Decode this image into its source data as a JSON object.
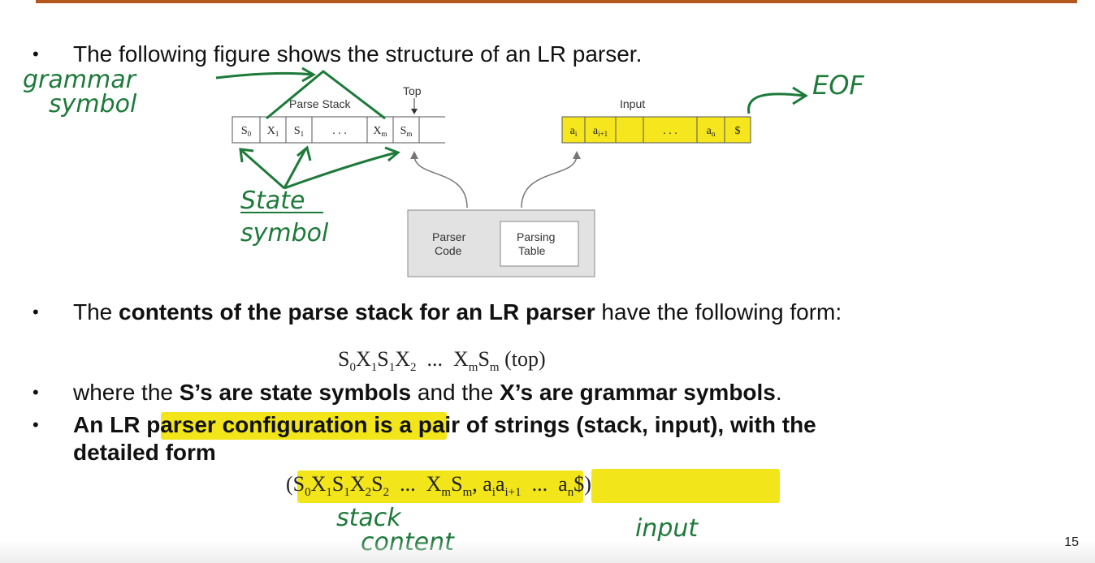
{
  "slide": {
    "bullet1": "The following figure shows the structure of an LR parser.",
    "bullet2": {
      "pre": "The ",
      "bold": "contents of the parse stack for an LR parser",
      "post": " have the following form:"
    },
    "stack_form": {
      "s0": "S",
      "s0sub": "0",
      "x1": "X",
      "x1sub": "1",
      "s1": "S",
      "s1sub": "1",
      "x2": "X",
      "x2sub": "2",
      "dots": "...",
      "xm": "X",
      "xmsub": "m",
      "sm": "S",
      "smsub": "m",
      "top": "(top)"
    },
    "bullet3": {
      "pre": "where the ",
      "bold1": "S’s are state symbols",
      "mid": " and the ",
      "bold2": "X’s are grammar symbols",
      "post": "."
    },
    "bullet4": {
      "bold": "An LR parser configuration",
      "rest": " is a pair of strings (stack, input), with the",
      "line2": "detailed form"
    },
    "config": {
      "open": "(",
      "s0": "S",
      "s0sub": "0",
      "x1": "X",
      "x1sub": "1",
      "s1": "S",
      "s1sub": "1",
      "x2": "X",
      "x2sub": "2",
      "s2": "S",
      "s2sub": "2",
      "dots1": "...",
      "xm": "X",
      "xmsub": "m",
      "sm": "S",
      "smsub": "m",
      "comma": ",",
      "ai": "a",
      "aisub": "i",
      "ai1": "a",
      "ai1sub": "i+1",
      "dots2": "...",
      "an": "a",
      "ansub": "n",
      "dollar": "$",
      "close": ")"
    },
    "page_number": "15"
  },
  "figure": {
    "parse_stack_label": "Parse Stack",
    "top_label": "Top",
    "input_label": "Input",
    "stack_cells": [
      {
        "main": "S",
        "sub": "0"
      },
      {
        "main": "X",
        "sub": "1"
      },
      {
        "main": "S",
        "sub": "1"
      },
      {
        "main": ". . .",
        "sub": ""
      },
      {
        "main": "X",
        "sub": "m"
      },
      {
        "main": "S",
        "sub": "m"
      }
    ],
    "input_cells": [
      {
        "main": "a",
        "sub": "i"
      },
      {
        "main": "a",
        "sub": "i+1"
      },
      {
        "main": "",
        "sub": ""
      },
      {
        "main": ". . .",
        "sub": ""
      },
      {
        "main": "a",
        "sub": "n"
      },
      {
        "main": "$",
        "sub": ""
      }
    ],
    "parser_code": [
      "Parser",
      "Code"
    ],
    "parsing_table": [
      "Parsing",
      "Table"
    ],
    "input_highlight_color": "#f5e61e",
    "box_fill": "#e2e2e2"
  },
  "annotations": {
    "grammar_symbol": [
      "grammar",
      "symbol"
    ],
    "state_symbol": [
      "State",
      "symbol"
    ],
    "eof": "EOF",
    "stack_content": [
      "stack",
      "content"
    ],
    "input": "input",
    "ink_color": "#1d7a3a"
  }
}
